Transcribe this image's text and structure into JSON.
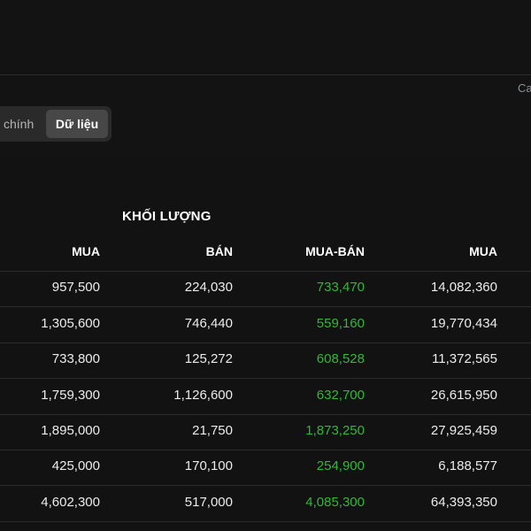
{
  "corner_text": "Ca",
  "tabs": {
    "inactive_label": "chính",
    "active_label": "Dữ liệu"
  },
  "table": {
    "group_header": "KHỐI LƯỢNG",
    "columns": [
      "MUA",
      "BÁN",
      "MUA-BÁN",
      "MUA"
    ],
    "rows": [
      [
        "957,500",
        "224,030",
        "733,470",
        "14,082,360"
      ],
      [
        "1,305,600",
        "746,440",
        "559,160",
        "19,770,434"
      ],
      [
        "733,800",
        "125,272",
        "608,528",
        "11,372,565"
      ],
      [
        "1,759,300",
        "1,126,600",
        "632,700",
        "26,615,950"
      ],
      [
        "1,895,000",
        "21,750",
        "1,873,250",
        "27,925,459"
      ],
      [
        "425,000",
        "170,100",
        "254,900",
        "6,188,577"
      ],
      [
        "4,602,300",
        "517,000",
        "4,085,300",
        "64,393,350"
      ]
    ]
  },
  "colors": {
    "positive": "#35b53a",
    "background": "#121212",
    "header_bg": "#131313"
  }
}
